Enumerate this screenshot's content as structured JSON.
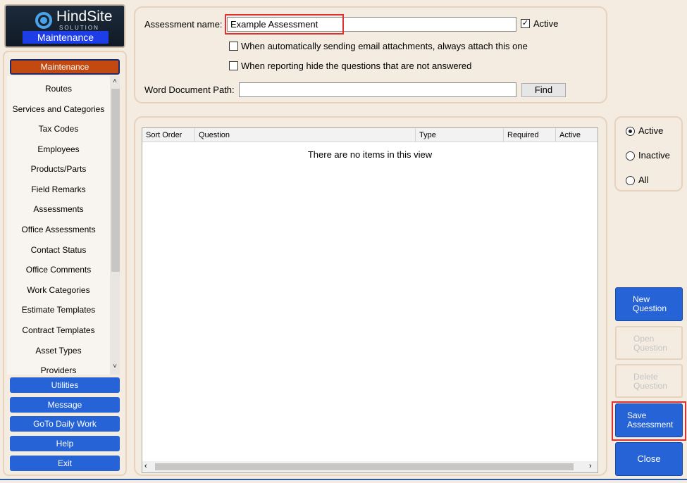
{
  "logo": {
    "word": "HindSite",
    "sub": "SOLUTION",
    "banner": "Maintenance"
  },
  "nav": {
    "active_label": "Maintenance",
    "items": [
      "Routes",
      "Services and Categories",
      "Tax Codes",
      "Employees",
      "Products/Parts",
      "Field Remarks",
      "Assessments",
      "Office Assessments",
      "Contact Status",
      "Office Comments",
      "Work Categories",
      "Estimate Templates",
      "Contract Templates",
      "Asset Types",
      "Providers"
    ],
    "buttons": [
      "Utilities",
      "Message",
      "GoTo Daily Work",
      "Help",
      "Exit"
    ]
  },
  "form": {
    "name_label": "Assessment name:",
    "name_value": "Example Assessment",
    "active_label": "Active",
    "active_checked": true,
    "attach_label": "When automatically sending email attachments, always attach this one",
    "attach_checked": false,
    "hide_label": "When reporting hide the questions that are not answered",
    "hide_checked": false,
    "path_label": "Word Document Path:",
    "path_value": "",
    "find_label": "Find"
  },
  "grid": {
    "columns": [
      "Sort Order",
      "Question",
      "Type",
      "Required",
      "Active"
    ],
    "empty_message": "There are no items in this view"
  },
  "filter": {
    "options": [
      "Active",
      "Inactive",
      "All"
    ],
    "selected": "Active"
  },
  "actions": {
    "new_question": "New Question",
    "open_question": "Open Question",
    "delete_question": "Delete Question",
    "save_assessment": "Save Assessment",
    "close": "Close"
  },
  "colors": {
    "accent": "#2563d6",
    "active_nav": "#c24a10",
    "highlight": "#e03030",
    "panel_bg": "#f4ebe1"
  }
}
